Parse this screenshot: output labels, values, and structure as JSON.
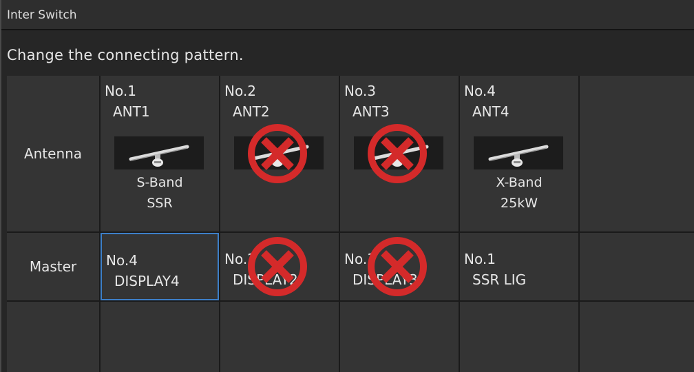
{
  "window": {
    "title": "Inter Switch"
  },
  "instruction": "Change the connecting pattern.",
  "rows": {
    "antenna_label": "Antenna",
    "master_label": "Master"
  },
  "antennas": [
    {
      "number": "No.1",
      "name": "ANT1",
      "spec_line1": "S-Band",
      "spec_line2": "SSR",
      "available": true
    },
    {
      "number": "No.2",
      "name": "ANT2",
      "spec_line1": "",
      "spec_line2": "",
      "available": false
    },
    {
      "number": "No.3",
      "name": "ANT3",
      "spec_line1": "",
      "spec_line2": "",
      "available": false
    },
    {
      "number": "No.4",
      "name": "ANT4",
      "spec_line1": "X-Band",
      "spec_line2": "25kW",
      "available": true
    }
  ],
  "masters": [
    {
      "number": "No.4",
      "name": "DISPLAY4",
      "selected": true,
      "available": true
    },
    {
      "number": "No.2",
      "name": "DISPLAY2",
      "selected": false,
      "available": false
    },
    {
      "number": "No.3",
      "name": "DISPLAY3",
      "selected": false,
      "available": false
    },
    {
      "number": "No.1",
      "name": "SSR LIG",
      "selected": false,
      "available": true
    }
  ],
  "colors": {
    "background": "#262626",
    "cell": "#343434",
    "selected_border": "#3d7fc8",
    "unavailable_mark": "#d42a2a"
  },
  "icons": {
    "antenna": "radar-antenna-icon",
    "unavailable": "unavailable-x-icon"
  }
}
